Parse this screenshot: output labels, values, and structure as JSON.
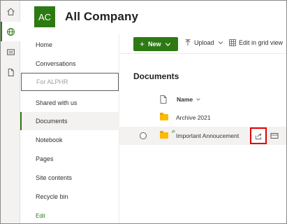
{
  "rail": {
    "icons": [
      "home-icon",
      "globe-icon",
      "news-icon",
      "document-icon"
    ]
  },
  "site": {
    "logo_text": "AC",
    "title": "All Company",
    "accent": "#2d7a14"
  },
  "nav": {
    "items": [
      {
        "label": "Home"
      },
      {
        "label": "Conversations"
      },
      {
        "label": "Shared with us"
      },
      {
        "label": "Documents",
        "selected": true
      },
      {
        "label": "Notebook"
      },
      {
        "label": "Pages"
      },
      {
        "label": "Site contents"
      },
      {
        "label": "Recycle bin"
      }
    ],
    "input_value": "For ALPHR",
    "edit_label": "Edit"
  },
  "commandbar": {
    "new_label": "New",
    "upload_label": "Upload",
    "grid_label": "Edit in grid view"
  },
  "library": {
    "title": "Documents",
    "name_header": "Name",
    "rows": [
      {
        "name": "Archive 2021",
        "type": "folder"
      },
      {
        "name": "Important Annoucement",
        "type": "folder",
        "hovered": true
      }
    ],
    "highlight_color": "#e00000"
  }
}
